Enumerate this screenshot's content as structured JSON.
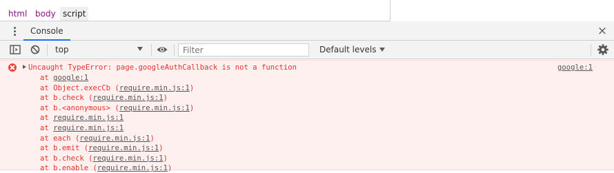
{
  "breadcrumb": {
    "items": [
      "html",
      "body",
      "script"
    ],
    "selected": "script"
  },
  "drawer": {
    "tab_label": "Console",
    "close_glyph": "×"
  },
  "toolbar": {
    "context_value": "top",
    "filter_placeholder": "Filter",
    "levels_label": "Default levels"
  },
  "icons": {
    "sidebar_toggle": "sidebar-toggle-icon",
    "clear": "clear-console-icon",
    "eye": "live-expression-icon",
    "settings": "gear-icon",
    "error": "error-icon"
  },
  "colors": {
    "error_text": "#e3312c",
    "error_bg": "#fff0f0",
    "accent": "#1a73e8",
    "tag": "#881280"
  },
  "console": {
    "error": {
      "message": "Uncaught TypeError: page.googleAuthCallback is not a function",
      "source": "google:1",
      "stack": [
        {
          "prefix": "at ",
          "func": "",
          "link": "google:1"
        },
        {
          "prefix": "at ",
          "func": "Object.execCb (",
          "link": "require.min.js:1",
          "suffix": ")"
        },
        {
          "prefix": "at ",
          "func": "b.check (",
          "link": "require.min.js:1",
          "suffix": ")"
        },
        {
          "prefix": "at ",
          "func": "b.<anonymous> (",
          "link": "require.min.js:1",
          "suffix": ")"
        },
        {
          "prefix": "at ",
          "func": "",
          "link": "require.min.js:1"
        },
        {
          "prefix": "at ",
          "func": "",
          "link": "require.min.js:1"
        },
        {
          "prefix": "at ",
          "func": "each (",
          "link": "require.min.js:1",
          "suffix": ")"
        },
        {
          "prefix": "at ",
          "func": "b.emit (",
          "link": "require.min.js:1",
          "suffix": ")"
        },
        {
          "prefix": "at ",
          "func": "b.check (",
          "link": "require.min.js:1",
          "suffix": ")"
        },
        {
          "prefix": "at ",
          "func": "b.enable (",
          "link": "require.min.js:1",
          "suffix": ")"
        }
      ]
    }
  }
}
